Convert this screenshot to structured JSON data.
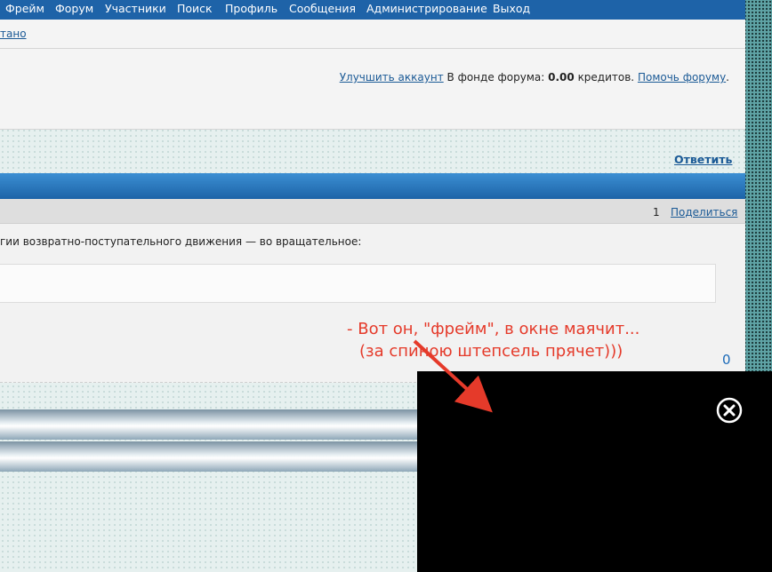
{
  "nav": {
    "items": [
      "Фрейм",
      "Форум",
      "Участники",
      "Поиск",
      "Профиль",
      "Сообщения",
      "Администрирование",
      "Выход"
    ]
  },
  "info_bar": {
    "text": "тано"
  },
  "account_bar": {
    "upgrade_link": "Улучшить аккаунт",
    "fund_text": "В фонде форума:",
    "fund_amount": "0.00",
    "fund_unit": "кредитов.",
    "help_link": "Помочь форуму",
    "dot": "."
  },
  "topic": {
    "reply_link": "Ответить"
  },
  "post": {
    "number": "1",
    "share_link": "Поделиться",
    "text": "гии возвратно-поступательного движения — во вращательное:",
    "counter": "0"
  },
  "annotation": {
    "line1": "- Вот он, \"фрейм\", в окне маячит...",
    "line2": "(за спиною штепсель прячет)))",
    "color": "#e53a2a"
  },
  "overlay": {
    "close_icon": "close-circle-icon"
  }
}
